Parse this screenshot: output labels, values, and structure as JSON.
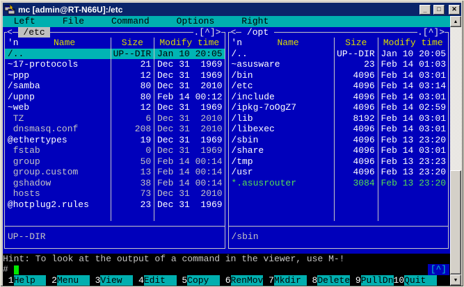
{
  "window": {
    "title": "mc [admin@RT-N66U]:/etc",
    "minimize_glyph": "_",
    "maximize_glyph": "□",
    "close_glyph": "✕",
    "scroll_up_glyph": "▲",
    "scroll_down_glyph": "▼"
  },
  "menu": {
    "items": [
      "Left",
      "File",
      "Command",
      "Options",
      "Right"
    ]
  },
  "panels": [
    {
      "path": "/etc",
      "active": true,
      "back_marker": "<",
      "up_marker": ".[^]>",
      "sort_indicator": "'n",
      "columns": [
        "Name",
        "Size",
        "Modify time"
      ],
      "rows": [
        {
          "name": "/..",
          "size": "UP--DIR",
          "date": "Jan 10 20:05",
          "type": "updir",
          "selected": true
        },
        {
          "name": "~17-protocols",
          "size": "21",
          "date": "Dec 31  1969",
          "type": "link"
        },
        {
          "name": "~ppp",
          "size": "12",
          "date": "Dec 31  1969",
          "type": "link"
        },
        {
          "name": "/samba",
          "size": "80",
          "date": "Dec 31  2010",
          "type": "dir"
        },
        {
          "name": "/upnp",
          "size": "80",
          "date": "Feb 14 00:12",
          "type": "dir"
        },
        {
          "name": "~web",
          "size": "12",
          "date": "Dec 31  1969",
          "type": "link"
        },
        {
          "name": " TZ",
          "size": "6",
          "date": "Dec 31  2010",
          "type": "file"
        },
        {
          "name": " dnsmasq.conf",
          "size": "208",
          "date": "Dec 31  2010",
          "type": "file"
        },
        {
          "name": "@ethertypes",
          "size": "19",
          "date": "Dec 31  1969",
          "type": "link"
        },
        {
          "name": " fstab",
          "size": "0",
          "date": "Dec 31  1969",
          "type": "file"
        },
        {
          "name": " group",
          "size": "50",
          "date": "Feb 14 00:14",
          "type": "file"
        },
        {
          "name": " group.custom",
          "size": "13",
          "date": "Feb 14 00:14",
          "type": "file"
        },
        {
          "name": " gshadow",
          "size": "38",
          "date": "Feb 14 00:14",
          "type": "file"
        },
        {
          "name": " hosts",
          "size": "73",
          "date": "Dec 31  2010",
          "type": "file"
        },
        {
          "name": "@hotplug2.rules",
          "size": "23",
          "date": "Dec 31  1969",
          "type": "link"
        }
      ],
      "status": "UP--DIR"
    },
    {
      "path": "/opt",
      "active": false,
      "back_marker": "<",
      "up_marker": ".[^]>",
      "sort_indicator": "'n",
      "columns": [
        "Name",
        "Size",
        "Modify time"
      ],
      "rows": [
        {
          "name": "/..",
          "size": "UP--DIR",
          "date": "Jan 10 20:05",
          "type": "updir"
        },
        {
          "name": "~asusware",
          "size": "23",
          "date": "Feb 14 01:03",
          "type": "link"
        },
        {
          "name": "/bin",
          "size": "4096",
          "date": "Feb 14 03:01",
          "type": "dir"
        },
        {
          "name": "/etc",
          "size": "4096",
          "date": "Feb 14 03:14",
          "type": "dir"
        },
        {
          "name": "/include",
          "size": "4096",
          "date": "Feb 14 03:01",
          "type": "dir"
        },
        {
          "name": "/ipkg-7oOgZ7",
          "size": "4096",
          "date": "Feb 14 02:59",
          "type": "dir"
        },
        {
          "name": "/lib",
          "size": "8192",
          "date": "Feb 14 03:01",
          "type": "dir"
        },
        {
          "name": "/libexec",
          "size": "4096",
          "date": "Feb 14 03:01",
          "type": "dir"
        },
        {
          "name": "/sbin",
          "size": "4096",
          "date": "Feb 13 23:20",
          "type": "dir"
        },
        {
          "name": "/share",
          "size": "4096",
          "date": "Feb 14 03:01",
          "type": "dir"
        },
        {
          "name": "/tmp",
          "size": "4096",
          "date": "Feb 13 23:23",
          "type": "dir"
        },
        {
          "name": "/usr",
          "size": "4096",
          "date": "Feb 13 23:20",
          "type": "dir"
        },
        {
          "name": "*.asusrouter",
          "size": "3084",
          "date": "Feb 13 23:20",
          "type": "exec"
        }
      ],
      "status": "/sbin"
    }
  ],
  "hint": {
    "text": "Hint: To look at the output of a command in the viewer, use M-!"
  },
  "command_line": {
    "prompt": "# ",
    "up_marker": "[^]"
  },
  "function_keys": [
    {
      "num": "1",
      "label": "Help"
    },
    {
      "num": "2",
      "label": "Menu"
    },
    {
      "num": "3",
      "label": "View"
    },
    {
      "num": "4",
      "label": "Edit"
    },
    {
      "num": "5",
      "label": "Copy"
    },
    {
      "num": "6",
      "label": "RenMov"
    },
    {
      "num": "7",
      "label": "Mkdir"
    },
    {
      "num": "8",
      "label": "Delete"
    },
    {
      "num": "9",
      "label": "PullDn"
    },
    {
      "num": "10",
      "label": "Quit"
    }
  ],
  "colors": {
    "panel_bg": "#0000BB",
    "menu_cyan": "#00AFAF",
    "selection_cyan": "#00B4B4",
    "header_yellow": "#DCDC00",
    "bright_white": "#FFFFFF",
    "gray_text": "#C4C4C4",
    "exec_green": "#55DD55",
    "cursor_green": "#00E800",
    "titlebar_blue": "#0A246A",
    "frame_gray": "#D4D0C8",
    "terminal_black": "#000000"
  }
}
